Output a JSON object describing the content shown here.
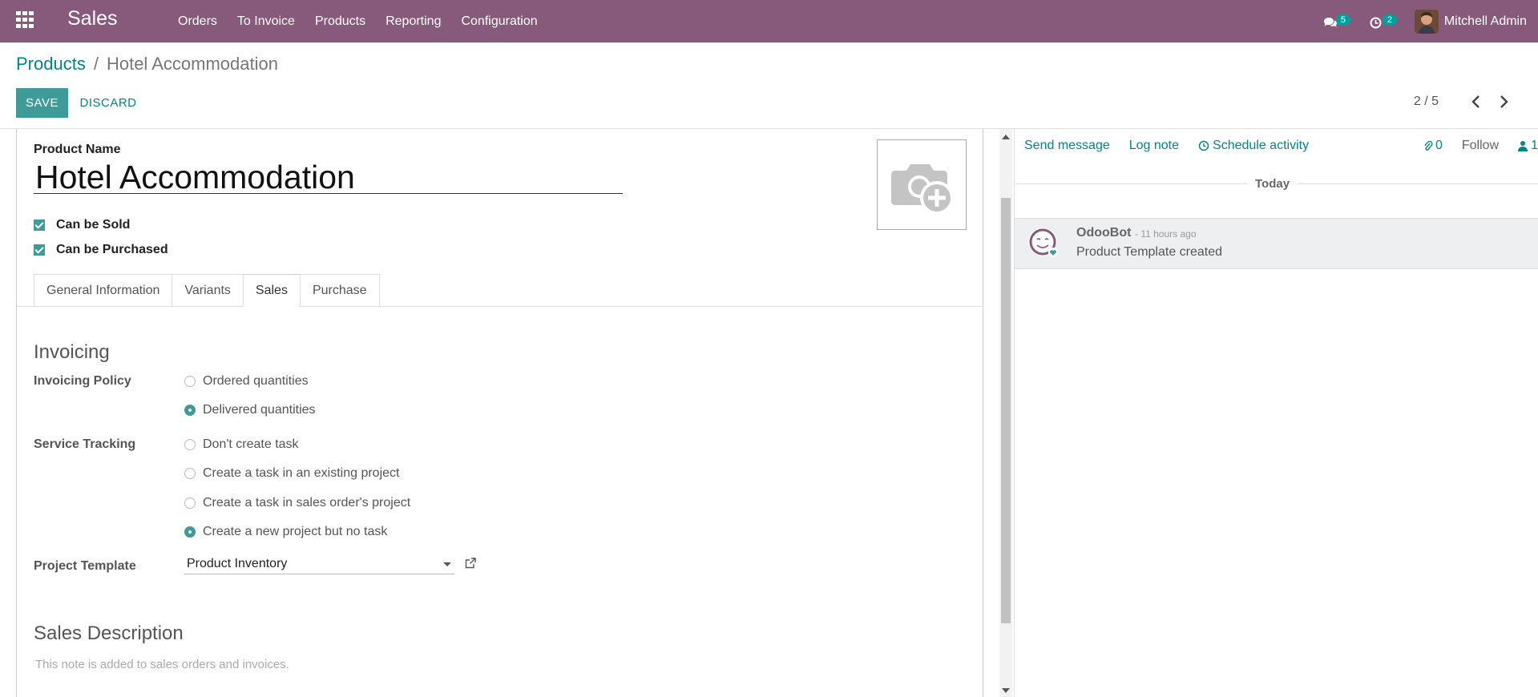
{
  "navbar": {
    "app_name": "Sales",
    "menu": [
      "Orders",
      "To Invoice",
      "Products",
      "Reporting",
      "Configuration"
    ],
    "messages_count": "5",
    "activities_count": "2",
    "user_name": "Mitchell Admin",
    "color": "#875a7b"
  },
  "breadcrumb": {
    "parent": "Products",
    "separator": "/",
    "current": "Hotel Accommodation"
  },
  "actions": {
    "save_label": "SAVE",
    "discard_label": "DISCARD"
  },
  "pager": {
    "value": "2 / 5"
  },
  "form": {
    "product_name_label": "Product Name",
    "product_name": "Hotel Accommodation",
    "can_be_sold": {
      "label": "Can be Sold",
      "checked": true
    },
    "can_be_purchased": {
      "label": "Can be Purchased",
      "checked": true
    },
    "tabs": [
      {
        "label": "General Information",
        "active": false
      },
      {
        "label": "Variants",
        "active": false
      },
      {
        "label": "Sales",
        "active": true
      },
      {
        "label": "Purchase",
        "active": false
      }
    ],
    "invoicing": {
      "title": "Invoicing",
      "policy_label": "Invoicing Policy",
      "policy_options": [
        {
          "label": "Ordered quantities",
          "selected": false
        },
        {
          "label": "Delivered quantities",
          "selected": true
        }
      ],
      "tracking_label": "Service Tracking",
      "tracking_options": [
        {
          "label": "Don't create task",
          "selected": false
        },
        {
          "label": "Create a task in an existing project",
          "selected": false
        },
        {
          "label": "Create a task in sales order's project",
          "selected": false
        },
        {
          "label": "Create a new project but no task",
          "selected": true
        }
      ],
      "project_template_label": "Project Template",
      "project_template_value": "Product Inventory"
    },
    "sales_description": {
      "title": "Sales Description",
      "placeholder": "This note is added to sales orders and invoices."
    }
  },
  "chatter": {
    "send_message": "Send message",
    "log_note": "Log note",
    "schedule_activity": "Schedule activity",
    "attachments_count": "0",
    "follow": "Follow",
    "followers_count": "1",
    "date_separator": "Today",
    "messages": [
      {
        "author": "OdooBot",
        "time": "- 11 hours ago",
        "body": "Product Template created"
      }
    ]
  },
  "colors": {
    "primary": "#3f9b98",
    "link": "#008784"
  }
}
